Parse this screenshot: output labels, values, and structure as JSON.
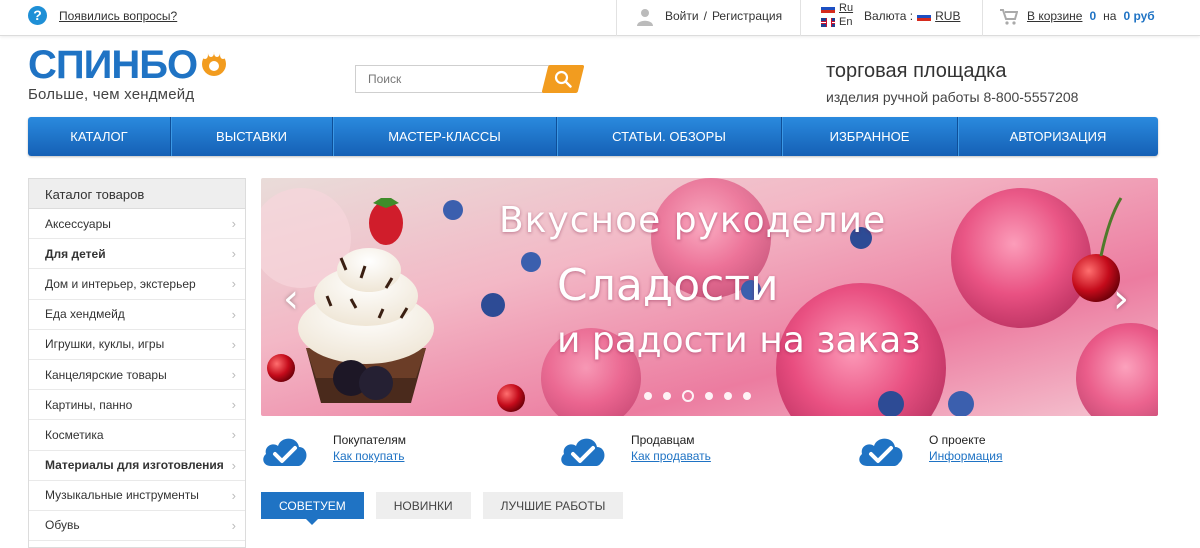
{
  "topbar": {
    "help_icon": "question-circle-icon",
    "help_link": "Появились вопросы?",
    "login": "Войти",
    "slash": "/",
    "register": "Регистрация",
    "languages": [
      {
        "code": "Ru",
        "flag": "russia-flag-icon"
      },
      {
        "code": "En",
        "flag": "uk-flag-icon"
      }
    ],
    "currency_label": "Валюта :",
    "currency_value": "RUB",
    "cart_label": "В корзине",
    "cart_count": "0",
    "cart_on": "на",
    "cart_sum": "0 руб"
  },
  "logo": {
    "name": "СПИНБО",
    "slogan": "Больше, чем хендмейд"
  },
  "search": {
    "placeholder": "Поиск",
    "button_icon": "search-icon"
  },
  "promo": {
    "title": "торговая площадка",
    "subtitle": "изделия ручной работы 8-800-5557208"
  },
  "nav": [
    {
      "label": "Каталог"
    },
    {
      "label": "Выставки"
    },
    {
      "label": "Мастер-классы"
    },
    {
      "label": "Статьи. Обзоры"
    },
    {
      "label": "Избранное"
    },
    {
      "label": "Авторизация"
    }
  ],
  "sidebar": {
    "title": "Каталог товаров",
    "items": [
      {
        "label": "Аксессуары",
        "bold": false
      },
      {
        "label": "Для детей",
        "bold": true
      },
      {
        "label": "Дом и интерьер, экстерьер",
        "bold": false
      },
      {
        "label": "Еда хендмейд",
        "bold": false
      },
      {
        "label": "Игрушки, куклы, игры",
        "bold": false
      },
      {
        "label": "Канцелярские товары",
        "bold": false
      },
      {
        "label": "Картины, панно",
        "bold": false
      },
      {
        "label": "Косметика",
        "bold": false
      },
      {
        "label": "Материалы для изготовления",
        "bold": true
      },
      {
        "label": "Музыкальные инструменты",
        "bold": false
      },
      {
        "label": "Обувь",
        "bold": false
      }
    ],
    "arrow": "›"
  },
  "slider": {
    "line1": "Вкусное рукоделие",
    "line2": "Сладости",
    "line3": "и радости на заказ",
    "prev": "‹",
    "next": "›",
    "slide_count": 6,
    "active_slide": 3
  },
  "features": [
    {
      "title": "Покупателям",
      "link": "Как покупать",
      "icon": "cloud-check-icon"
    },
    {
      "title": "Продавцам",
      "link": "Как продавать",
      "icon": "cloud-check-icon"
    },
    {
      "title": "О проекте",
      "link": "Информация",
      "icon": "cloud-check-icon"
    }
  ],
  "tabs": [
    {
      "label": "Советуем",
      "active": true
    },
    {
      "label": "Новинки",
      "active": false
    },
    {
      "label": "Лучшие работы",
      "active": false
    }
  ],
  "colors": {
    "brand_blue": "#1f73c4",
    "accent_orange": "#f29c1f",
    "nav_top": "#2a8ade",
    "nav_bottom": "#1560b5"
  }
}
